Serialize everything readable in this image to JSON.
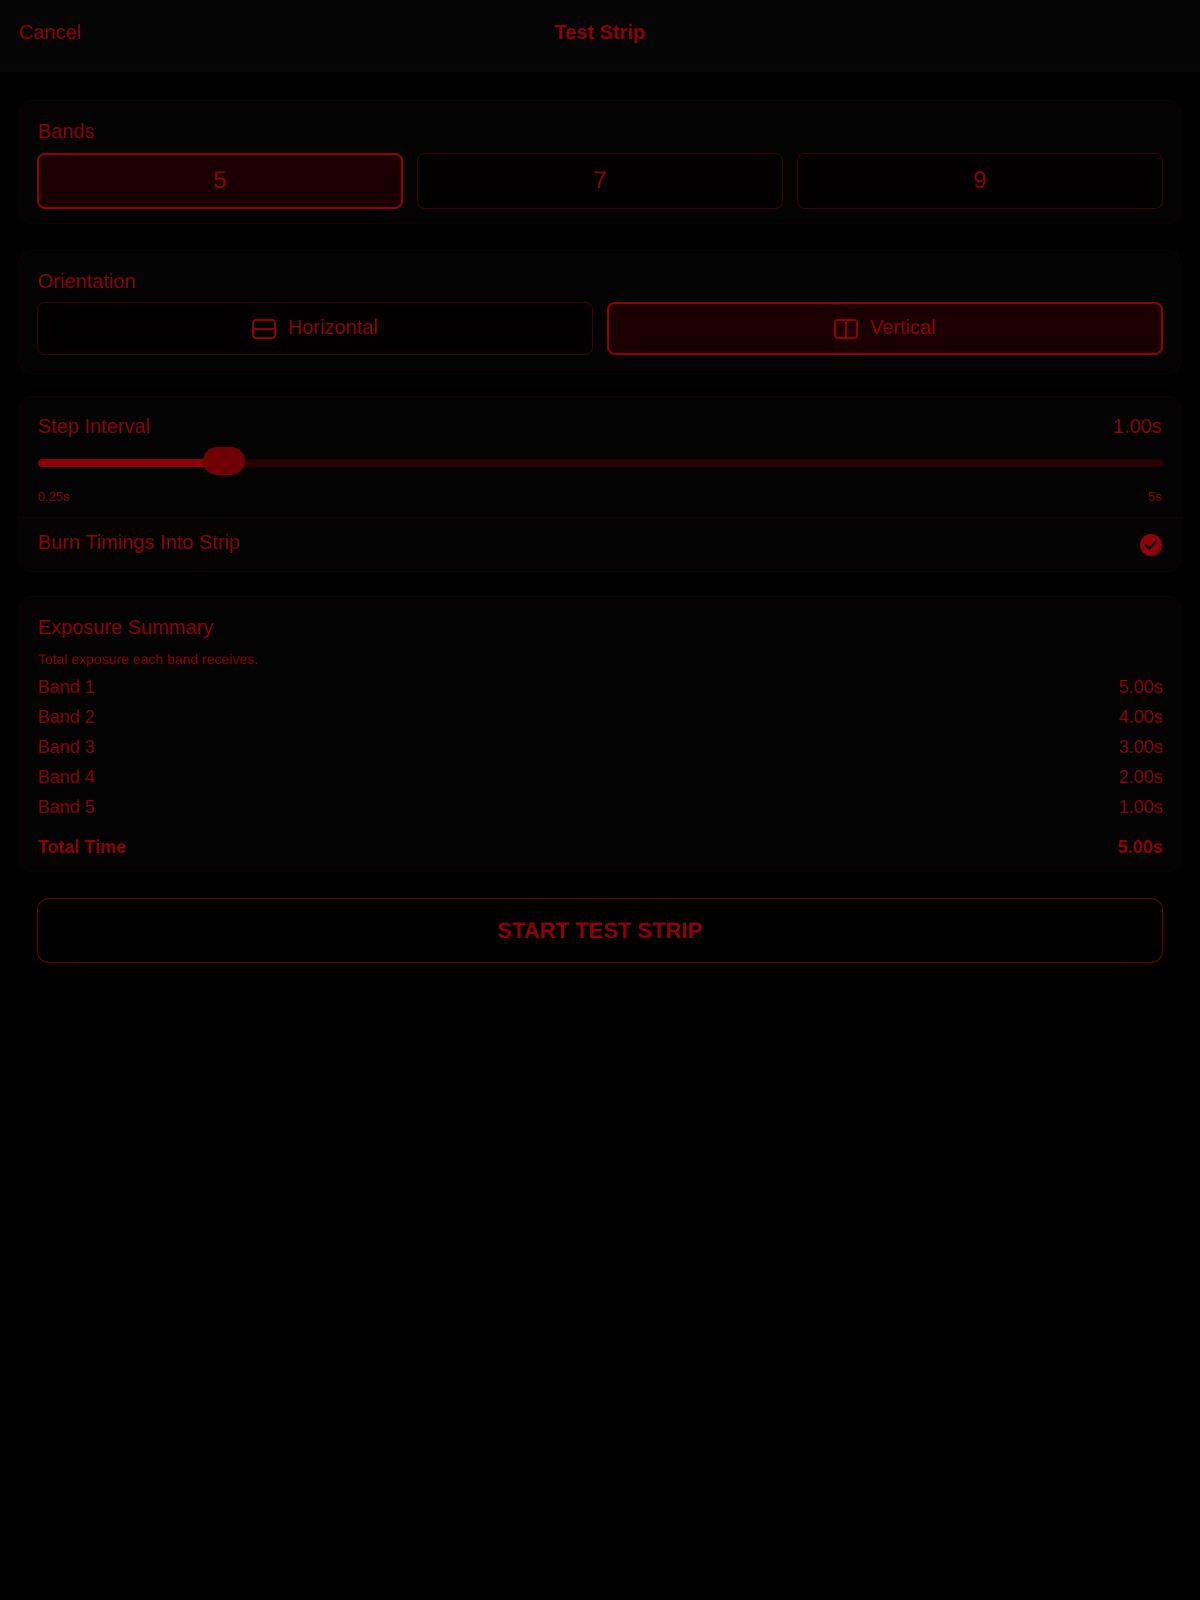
{
  "header": {
    "cancel_label": "Cancel",
    "title": "Test Strip"
  },
  "bands": {
    "label": "Bands",
    "options": [
      "5",
      "7",
      "9"
    ],
    "selected": "5"
  },
  "orientation": {
    "label": "Orientation",
    "options": [
      {
        "label": "Horizontal",
        "icon": "horizontal-split-icon"
      },
      {
        "label": "Vertical",
        "icon": "vertical-split-icon"
      }
    ],
    "selected": "Vertical"
  },
  "step_interval": {
    "label": "Step Interval",
    "value_text": "1.00s",
    "value": 1.0,
    "min": 0.25,
    "max": 5,
    "min_label": "0.25s",
    "max_label": "5s"
  },
  "burn_timings": {
    "label": "Burn Timings Into Strip",
    "checked": true,
    "icon": "checkmark-circle-icon"
  },
  "summary": {
    "title": "Exposure Summary",
    "subtitle": "Total exposure each band receives.",
    "bands": [
      {
        "name": "Band 1",
        "value": "5.00s"
      },
      {
        "name": "Band 2",
        "value": "4.00s"
      },
      {
        "name": "Band 3",
        "value": "3.00s"
      },
      {
        "name": "Band 4",
        "value": "2.00s"
      },
      {
        "name": "Band 5",
        "value": "1.00s"
      }
    ],
    "total_label": "Total Time",
    "total_value": "5.00s"
  },
  "start_button": {
    "label": "START TEST STRIP"
  },
  "colors": {
    "accent": "#8f0008",
    "background": "#000000",
    "selected_fill": "#1a0002"
  }
}
